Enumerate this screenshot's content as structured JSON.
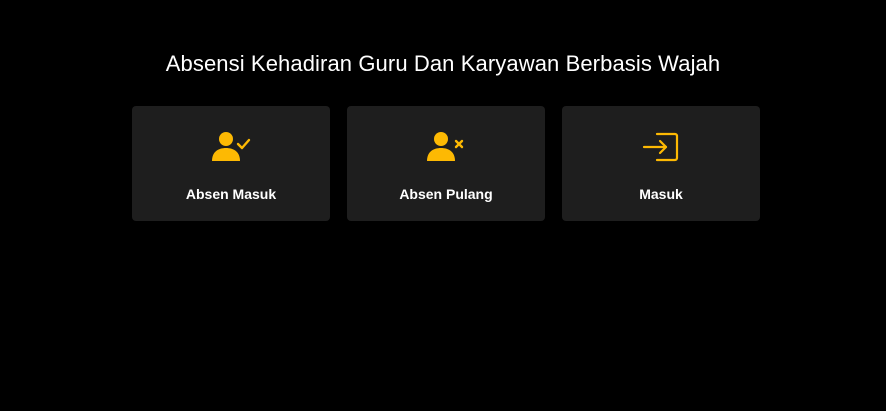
{
  "page": {
    "title": "Absensi Kehadiran Guru Dan Karyawan Berbasis Wajah"
  },
  "theme": {
    "background": "#000000",
    "card_background": "#1e1e1e",
    "accent": "#fdb903",
    "text": "#ffffff"
  },
  "cards": [
    {
      "label": "Absen Masuk",
      "icon": "user-check-icon"
    },
    {
      "label": "Absen Pulang",
      "icon": "user-x-icon"
    },
    {
      "label": "Masuk",
      "icon": "login-icon"
    }
  ]
}
